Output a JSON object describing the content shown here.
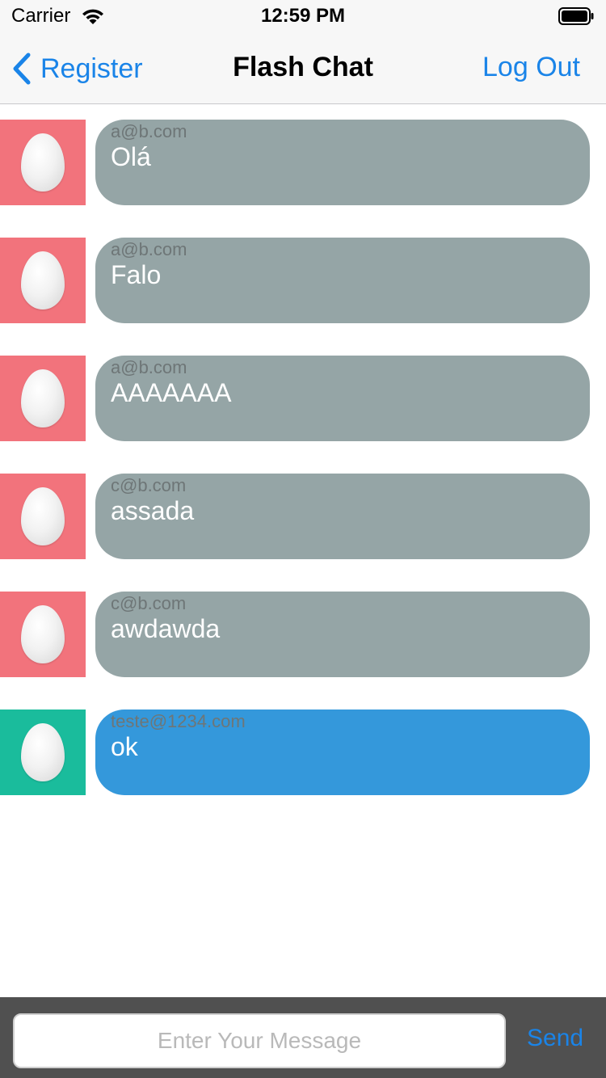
{
  "status_bar": {
    "carrier": "Carrier",
    "time": "12:59 PM",
    "wifi_icon": "wifi-icon",
    "battery_icon": "battery-full-icon"
  },
  "nav": {
    "back_label": "Register",
    "back_icon": "chevron-left-icon",
    "title": "Flash Chat",
    "logout_label": "Log Out"
  },
  "messages": [
    {
      "sender": "a@b.com",
      "text": "Olá",
      "avatar_color": "#f2737c",
      "bubble_color": "#95a5a6",
      "avatar_icon": "egg-icon"
    },
    {
      "sender": "a@b.com",
      "text": "Falo",
      "avatar_color": "#f2737c",
      "bubble_color": "#95a5a6",
      "avatar_icon": "egg-icon"
    },
    {
      "sender": "a@b.com",
      "text": "AAAAAAA",
      "avatar_color": "#f2737c",
      "bubble_color": "#95a5a6",
      "avatar_icon": "egg-icon"
    },
    {
      "sender": "c@b.com",
      "text": "assada",
      "avatar_color": "#f2737c",
      "bubble_color": "#95a5a6",
      "avatar_icon": "egg-icon"
    },
    {
      "sender": "c@b.com",
      "text": "awdawda",
      "avatar_color": "#f2737c",
      "bubble_color": "#95a5a6",
      "avatar_icon": "egg-icon"
    },
    {
      "sender": "teste@1234.com",
      "text": "ok",
      "avatar_color": "#1abc9c",
      "bubble_color": "#3498db",
      "avatar_icon": "egg-icon"
    }
  ],
  "composer": {
    "placeholder": "Enter Your Message",
    "value": "",
    "send_label": "Send"
  },
  "colors": {
    "accent": "#1a84e8",
    "composer_background": "#505050"
  }
}
